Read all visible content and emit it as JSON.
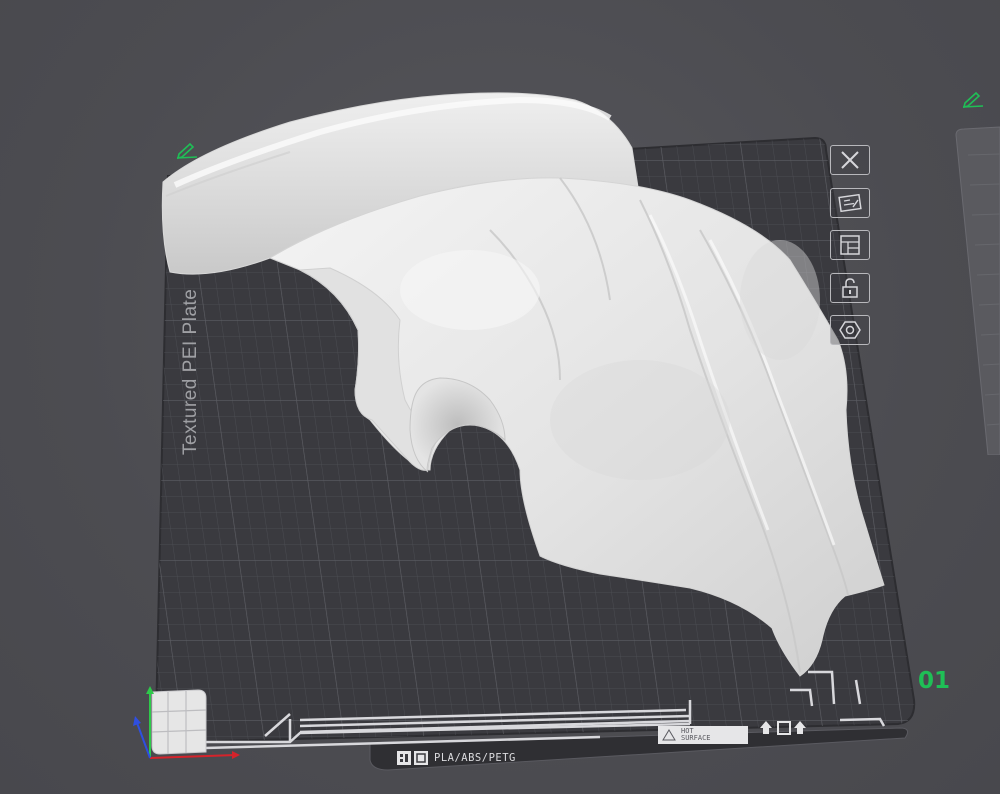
{
  "plate": {
    "label": "Textured PEI Plate",
    "number": "01",
    "material": "PLA/ABS/PETG",
    "hot_surface_line1": "HOT",
    "hot_surface_line2": "SURFACE"
  },
  "plate_tools": [
    {
      "name": "close-plate-button",
      "icon": "close-icon"
    },
    {
      "name": "plate-settings-button",
      "icon": "plate-settings-icon"
    },
    {
      "name": "arrange-button",
      "icon": "arrange-icon"
    },
    {
      "name": "lock-plate-button",
      "icon": "lock-icon"
    },
    {
      "name": "plate-orient-button",
      "icon": "hexagon-icon"
    }
  ],
  "colors": {
    "background": "#4d4d52",
    "plate": "#3a3a3f",
    "grid": "#55565c",
    "model": "#ececec",
    "accent_green": "#1fbf56"
  }
}
